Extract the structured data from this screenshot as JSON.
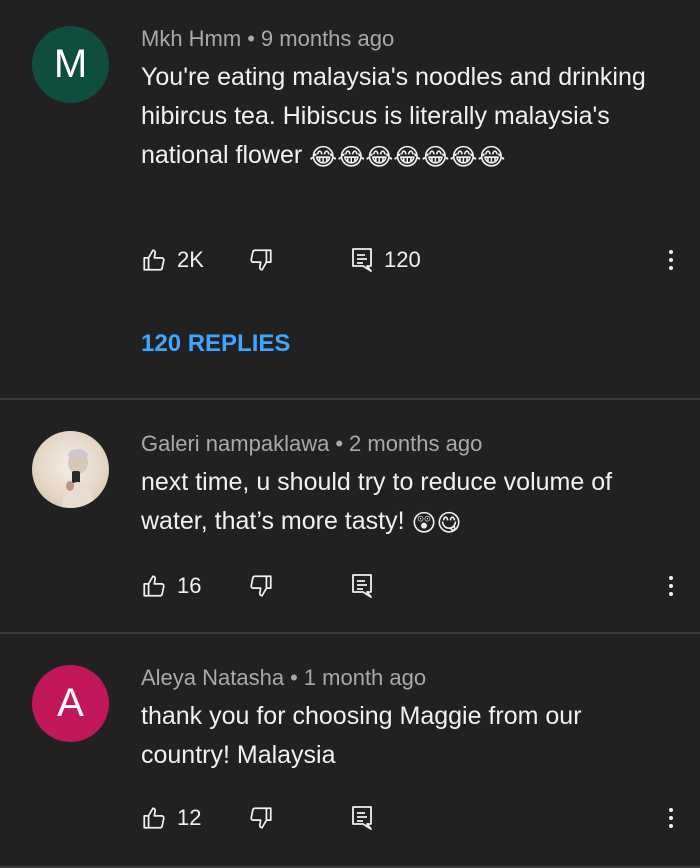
{
  "colors": {
    "background": "#212121",
    "divider": "#3a3a3a",
    "replies_link": "#3ea6ff",
    "avatar_m": "#0f4d3f",
    "avatar_a": "#c2185b"
  },
  "comments": [
    {
      "author": "Mkh Hmm",
      "separator": "•",
      "time": "9 months ago",
      "avatar_letter": "M",
      "text": "You're eating malaysia's noodles and drinking hibircus tea. Hibiscus is literally malaysia's national flower",
      "emojis": "😂😂😂😂😂😂😂",
      "likes": "2K",
      "reply_count": "120",
      "replies_link": "120 REPLIES"
    },
    {
      "author": "Galeri nampaklawa",
      "separator": "•",
      "time": "2 months ago",
      "avatar_letter": "",
      "text": "next time, u should try to reduce volume of water, that’s more tasty!",
      "emojis": "😲😋",
      "likes": "16",
      "reply_count": ""
    },
    {
      "author": "Aleya Natasha",
      "separator": "•",
      "time": "1 month ago",
      "avatar_letter": "A",
      "text": "thank you for choosing Maggie from our country! Malaysia",
      "emojis": "",
      "likes": "12",
      "reply_count": ""
    }
  ],
  "icons": {
    "like": "thumbs-up-icon",
    "dislike": "thumbs-down-icon",
    "reply": "comment-icon",
    "more": "more-vert-icon"
  }
}
